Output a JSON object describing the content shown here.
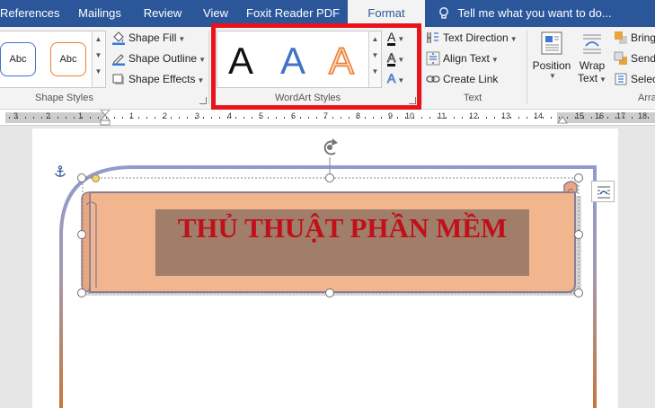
{
  "tabs": [
    {
      "label": "References"
    },
    {
      "label": "Mailings"
    },
    {
      "label": "Review"
    },
    {
      "label": "View"
    },
    {
      "label": "Foxit Reader PDF"
    },
    {
      "label": "Format"
    }
  ],
  "tell_me": {
    "label": "Tell me what you want to do..."
  },
  "shape_styles": {
    "group_label": "Shape Styles",
    "presets": [
      "Abc",
      "Abc"
    ],
    "fill_label": "Shape Fill",
    "outline_label": "Shape Outline",
    "effects_label": "Shape Effects"
  },
  "wordart_styles": {
    "group_label": "WordArt Styles",
    "letters": [
      "A",
      "A",
      "A"
    ],
    "text_fill_glyph": "A",
    "text_outline_glyph": "A",
    "text_effects_glyph": "A"
  },
  "text_group": {
    "group_label": "Text",
    "direction_label": "Text Direction",
    "align_label": "Align Text",
    "link_label": "Create Link"
  },
  "arrange": {
    "group_label": "Arra",
    "position_label": "Position",
    "wrap_label_1": "Wrap",
    "wrap_label_2": "Text",
    "bring_label": "Bring",
    "send_label": "Send",
    "select_label": "Selec"
  },
  "ruler": {
    "numbers": [
      "3",
      "2",
      "1",
      "1",
      "2",
      "3",
      "4",
      "5",
      "6",
      "7",
      "8",
      "9",
      "10",
      "11",
      "12",
      "13",
      "14",
      "15",
      "16",
      "17",
      "18"
    ]
  },
  "document": {
    "wordart_text": "THỦ THUẬT PHẦN MỀM"
  },
  "colors": {
    "accent": "#2b579a",
    "highlight_box": "#e8131b",
    "scroll_fill": "#f1b68e",
    "wordart_text": "#c0101a"
  }
}
